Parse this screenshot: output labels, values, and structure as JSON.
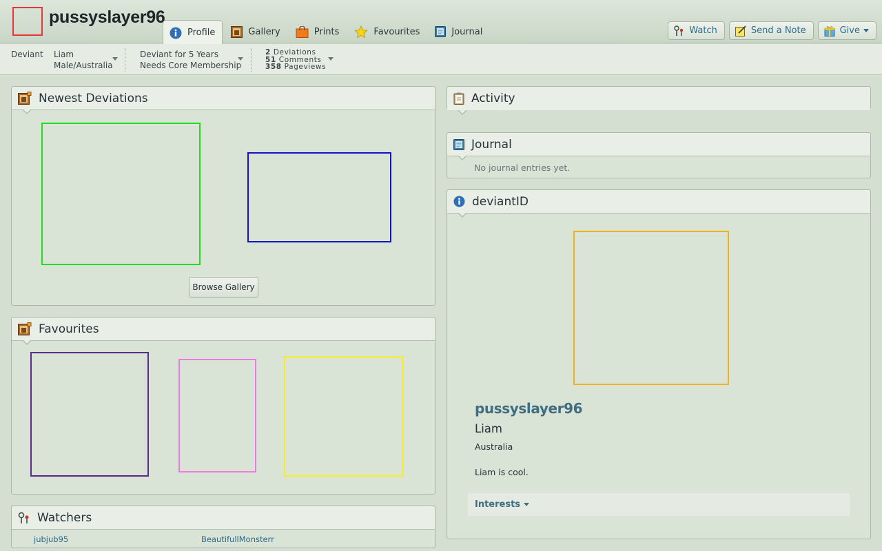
{
  "header": {
    "username": "pussyslayer96",
    "tabs": [
      {
        "label": "Profile",
        "icon": "info-icon",
        "active": true
      },
      {
        "label": "Gallery",
        "icon": "gallery-icon",
        "active": false
      },
      {
        "label": "Prints",
        "icon": "prints-bag-icon",
        "active": false
      },
      {
        "label": "Favourites",
        "icon": "star-icon",
        "active": false
      },
      {
        "label": "Journal",
        "icon": "journal-icon",
        "active": false
      }
    ],
    "actions": {
      "watch": "Watch",
      "note": "Send a Note",
      "give": "Give"
    }
  },
  "info": {
    "type": "Deviant",
    "name": "Liam",
    "gender_location": "Male/Australia",
    "membership_years": "Deviant for 5 Years",
    "membership_status": "Needs Core Membership",
    "stats": {
      "deviations_count": "2",
      "deviations_label": "Deviations",
      "comments_count": "51",
      "comments_label": "Comments",
      "pageviews_count": "358",
      "pageviews_label": "Pageviews"
    }
  },
  "newest": {
    "title": "Newest Deviations",
    "browse_label": "Browse Gallery",
    "thumbs": [
      {
        "name": "deviation-thumb-1",
        "color": "#22dd22"
      },
      {
        "name": "deviation-thumb-2",
        "color": "#1212c8"
      }
    ]
  },
  "favourites": {
    "title": "Favourites",
    "thumbs": [
      {
        "name": "favourite-thumb-1",
        "color": "#5a2c8a"
      },
      {
        "name": "favourite-thumb-2",
        "color": "#ef7ae6"
      },
      {
        "name": "favourite-thumb-3",
        "color": "#f4ee22"
      }
    ]
  },
  "watchers": {
    "title": "Watchers",
    "users": [
      "jubjub95",
      "BeautifullMonsterr"
    ]
  },
  "activity": {
    "title": "Activity"
  },
  "journal": {
    "title": "Journal",
    "empty_text": "No journal entries yet."
  },
  "deviantid": {
    "title": "deviantID",
    "photo_color": "#f0b020",
    "username": "pussyslayer96",
    "realname": "Liam",
    "location": "Australia",
    "bio": "Liam is cool.",
    "interests_label": "Interests"
  },
  "colors": {
    "background": "#d4dfd2",
    "link": "#2e6a8a",
    "avatar_border": "#e3393b"
  }
}
